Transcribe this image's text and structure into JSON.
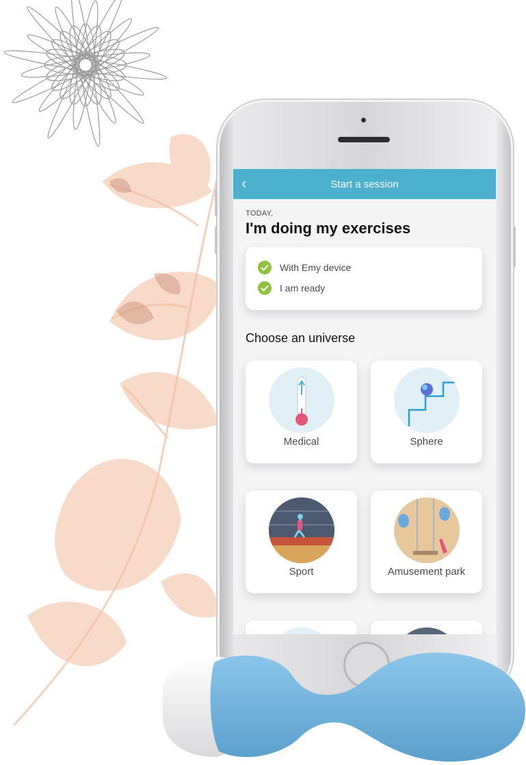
{
  "screen": {
    "title": "Start a session",
    "back_icon": "chevron-left-icon",
    "date_label": "TODAY,",
    "headline": "I'm doing my exercises",
    "checklist": [
      {
        "label": "With Emy device",
        "icon": "check-circle-icon"
      },
      {
        "label": "I am ready",
        "icon": "check-circle-icon"
      }
    ],
    "section_title": "Choose an universe",
    "universes": [
      {
        "label": "Medical"
      },
      {
        "label": "Sphere"
      },
      {
        "label": "Sport"
      },
      {
        "label": "Amusement park"
      }
    ]
  },
  "colors": {
    "accent": "#4bb1cf",
    "check_green": "#8fc23f",
    "device_blue": "#6fb2dc"
  }
}
